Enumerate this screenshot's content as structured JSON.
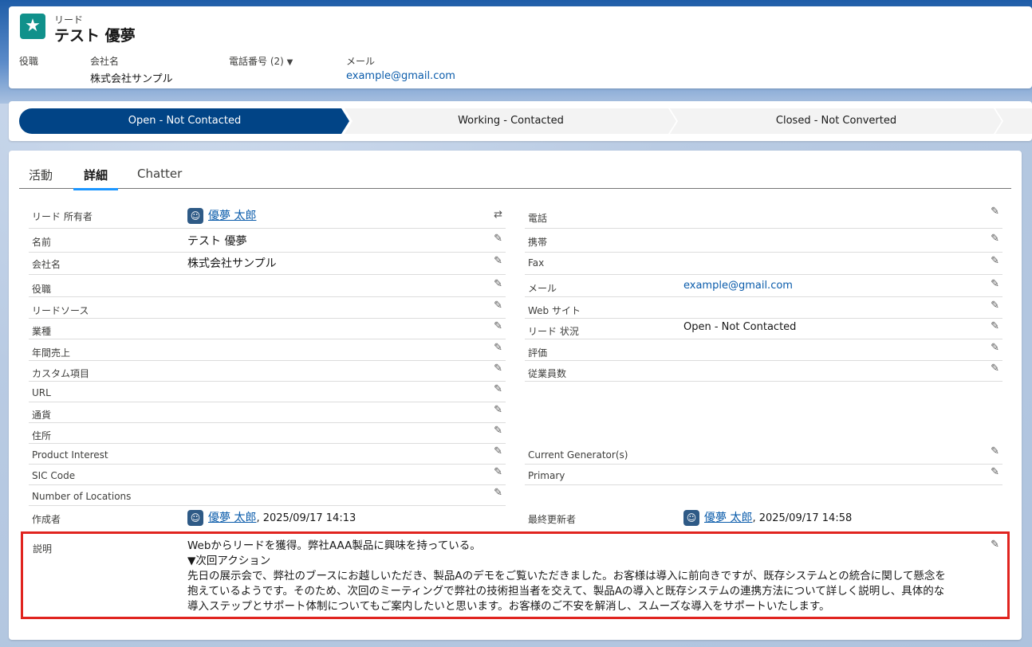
{
  "header": {
    "object_label": "リード",
    "title": "テスト 優夢",
    "fields": [
      {
        "label": "役職",
        "value": ""
      },
      {
        "label": "会社名",
        "value": "株式会社サンプル"
      },
      {
        "label": "電話番号 (2)",
        "value": ""
      },
      {
        "label": "メール",
        "value": "example@gmail.com"
      }
    ]
  },
  "path": {
    "stages": [
      "Open - Not Contacted",
      "Working - Contacted",
      "Closed - Not Converted"
    ],
    "current_index": 0,
    "colors": {
      "current": "#014486",
      "inactive": "#f3f3f3"
    }
  },
  "tabs": [
    "活動",
    "詳細",
    "Chatter"
  ],
  "active_tab": "詳細",
  "left_fields": [
    {
      "label": "リード 所有者",
      "value": "優夢 太郎"
    },
    {
      "label": "名前",
      "value": "テスト 優夢"
    },
    {
      "label": "会社名",
      "value": "株式会社サンプル"
    },
    {
      "label": "役職",
      "value": ""
    },
    {
      "label": "リードソース",
      "value": ""
    },
    {
      "label": "業種",
      "value": ""
    },
    {
      "label": "年間売上",
      "value": ""
    },
    {
      "label": "カスタム項目",
      "value": ""
    },
    {
      "label": "URL",
      "value": ""
    },
    {
      "label": "通貨",
      "value": ""
    },
    {
      "label": "住所",
      "value": ""
    },
    {
      "label": "Product Interest",
      "value": ""
    },
    {
      "label": "SIC Code",
      "value": ""
    },
    {
      "label": "Number of Locations",
      "value": ""
    }
  ],
  "right_fields": [
    {
      "label": "電話",
      "value": ""
    },
    {
      "label": "携帯",
      "value": ""
    },
    {
      "label": "Fax",
      "value": ""
    },
    {
      "label": "メール",
      "value": "example@gmail.com"
    },
    {
      "label": "Web サイト",
      "value": ""
    },
    {
      "label": "リード 状況",
      "value": "Open - Not Contacted"
    },
    {
      "label": "評価",
      "value": ""
    },
    {
      "label": "従業員数",
      "value": ""
    }
  ],
  "right_fields_lower": [
    {
      "label": "Current Generator(s)",
      "value": ""
    },
    {
      "label": "Primary",
      "value": ""
    }
  ],
  "created": {
    "label": "作成者",
    "user": "優夢 太郎",
    "datetime": ", 2025/09/17 14:13"
  },
  "modified": {
    "label": "最終更新者",
    "user": "優夢 太郎",
    "datetime": ", 2025/09/17 14:58"
  },
  "description": {
    "label": "説明",
    "lines": [
      "Webからリードを獲得。弊社AAA製品に興味を持っている。",
      "▼次回アクション",
      "先日の展示会で、弊社のブースにお越しいただき、製品Aのデモをご覧いただきました。お客様は導入に前向きですが、既存システムとの統合に関して懸念を",
      "抱えているようです。そのため、次回のミーティングで弊社の技術担当者を交えて、製品Aの導入と既存システムの連携方法について詳しく説明し、具体的な",
      "導入ステップとサポート体制についてもご案内したいと思います。お客様のご不安を解消し、スムーズな導入をサポートいたします。"
    ]
  }
}
